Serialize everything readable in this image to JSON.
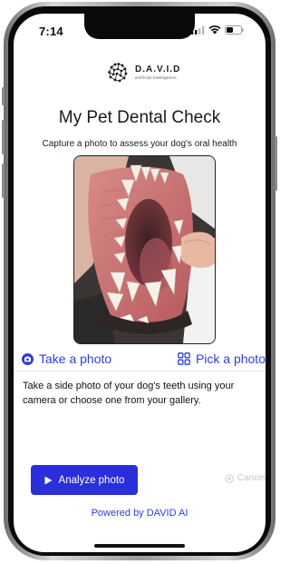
{
  "status_bar": {
    "time": "7:14",
    "icons": [
      "cellular-signal-icon",
      "wifi-icon",
      "battery-icon"
    ]
  },
  "brand": {
    "name": "D.A.V.I.D",
    "tagline": "artificial intelligence",
    "logo_icon": "brain-icon"
  },
  "header": {
    "title": "My Pet Dental Check",
    "subtitle": "Capture a photo to assess your dog's oral health"
  },
  "photo": {
    "content": "dog-teeth-photo"
  },
  "actions": {
    "take_photo_label": "Take a photo",
    "take_photo_icon": "camera-icon",
    "pick_photo_label": "Pick a photo",
    "pick_photo_icon": "grid-icon"
  },
  "instructions": {
    "text": "Take a side photo of your dog's teeth using your camera or choose one from your gallery."
  },
  "footer": {
    "analyze_label": "Analyze photo",
    "analyze_icon": "play-icon",
    "cancel_label": "Cancel",
    "cancel_icon": "close-circle-icon",
    "powered_by": "Powered by DAVID AI"
  },
  "colors": {
    "accent": "#2f3fd6",
    "button": "#2b2fd9",
    "disabled": "#c9c9cd"
  }
}
